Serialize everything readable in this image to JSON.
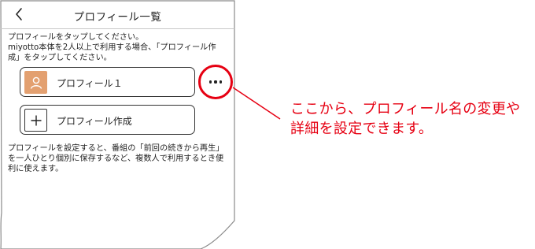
{
  "header": {
    "title": "プロフィール一覧"
  },
  "intro": {
    "text": "プロフィールをタップしてください。\nmiyotto本体を2人以上で利用する場合、「プロフィール作成」をタップしてください。"
  },
  "profiles": [
    {
      "label": "プロフィール１"
    }
  ],
  "create_profile": {
    "label": "プロフィール作成"
  },
  "footer_note": {
    "text": "プロフィールを設定すると、番組の「前回の続きから再生」を一人ひとり個別に保存するなど、複数人で利用するとき便利に使えます。"
  },
  "callout": {
    "text": "ここから、プロフィール名の変更や\n詳細を設定できます。",
    "color": "#e60012"
  },
  "colors": {
    "avatar": "#e3a070",
    "highlight": "#e60012"
  },
  "icons": {
    "back": "chevron-left-icon",
    "avatar": "person-icon",
    "add": "plus-icon",
    "more": "ellipsis-icon"
  }
}
